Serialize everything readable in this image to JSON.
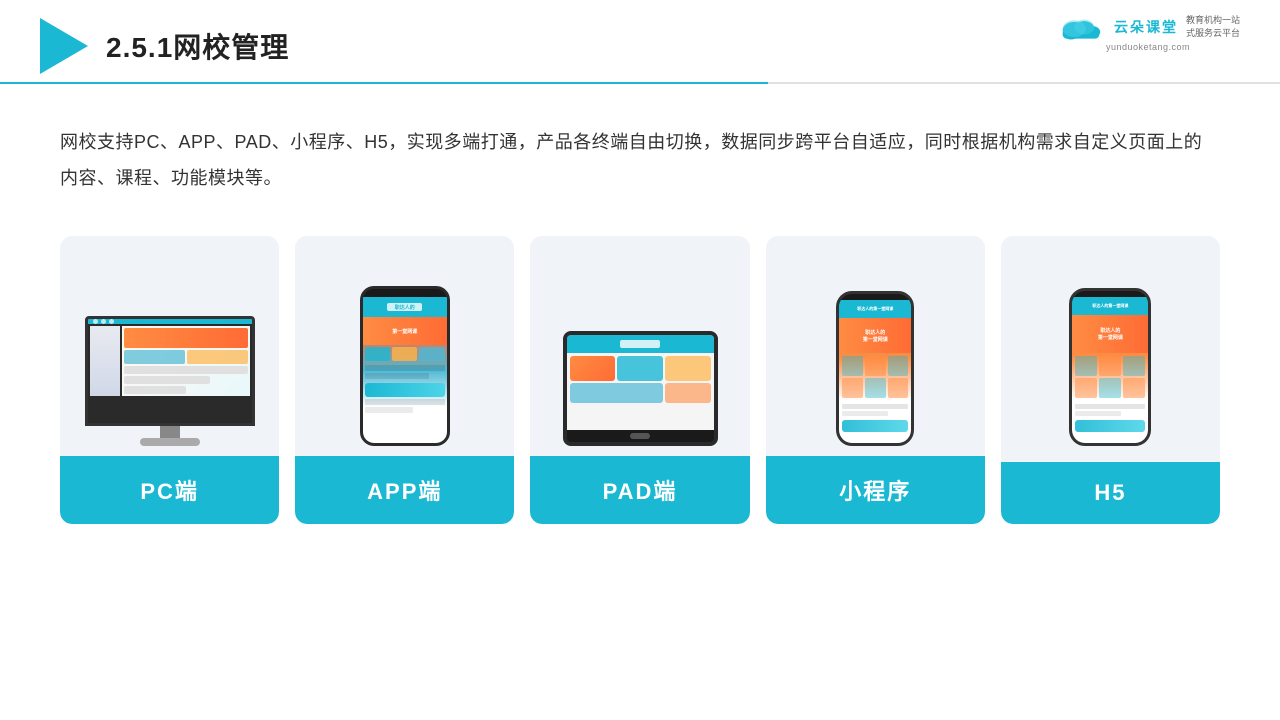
{
  "header": {
    "title": "2.5.1网校管理",
    "divider_color": "#1bb8d4"
  },
  "logo": {
    "name_cn": "云朵课堂",
    "url": "yunduoketang.com",
    "tagline": "教育机构一站\n式服务云平台"
  },
  "description": {
    "text": "网校支持PC、APP、PAD、小程序、H5，实现多端打通，产品各终端自由切换，数据同步跨平台自适应，同时根据机构需求自定义页面上的内容、课程、功能模块等。"
  },
  "cards": [
    {
      "id": "pc",
      "label": "PC端"
    },
    {
      "id": "app",
      "label": "APP端"
    },
    {
      "id": "pad",
      "label": "PAD端"
    },
    {
      "id": "mini",
      "label": "小程序"
    },
    {
      "id": "h5",
      "label": "H5"
    }
  ]
}
